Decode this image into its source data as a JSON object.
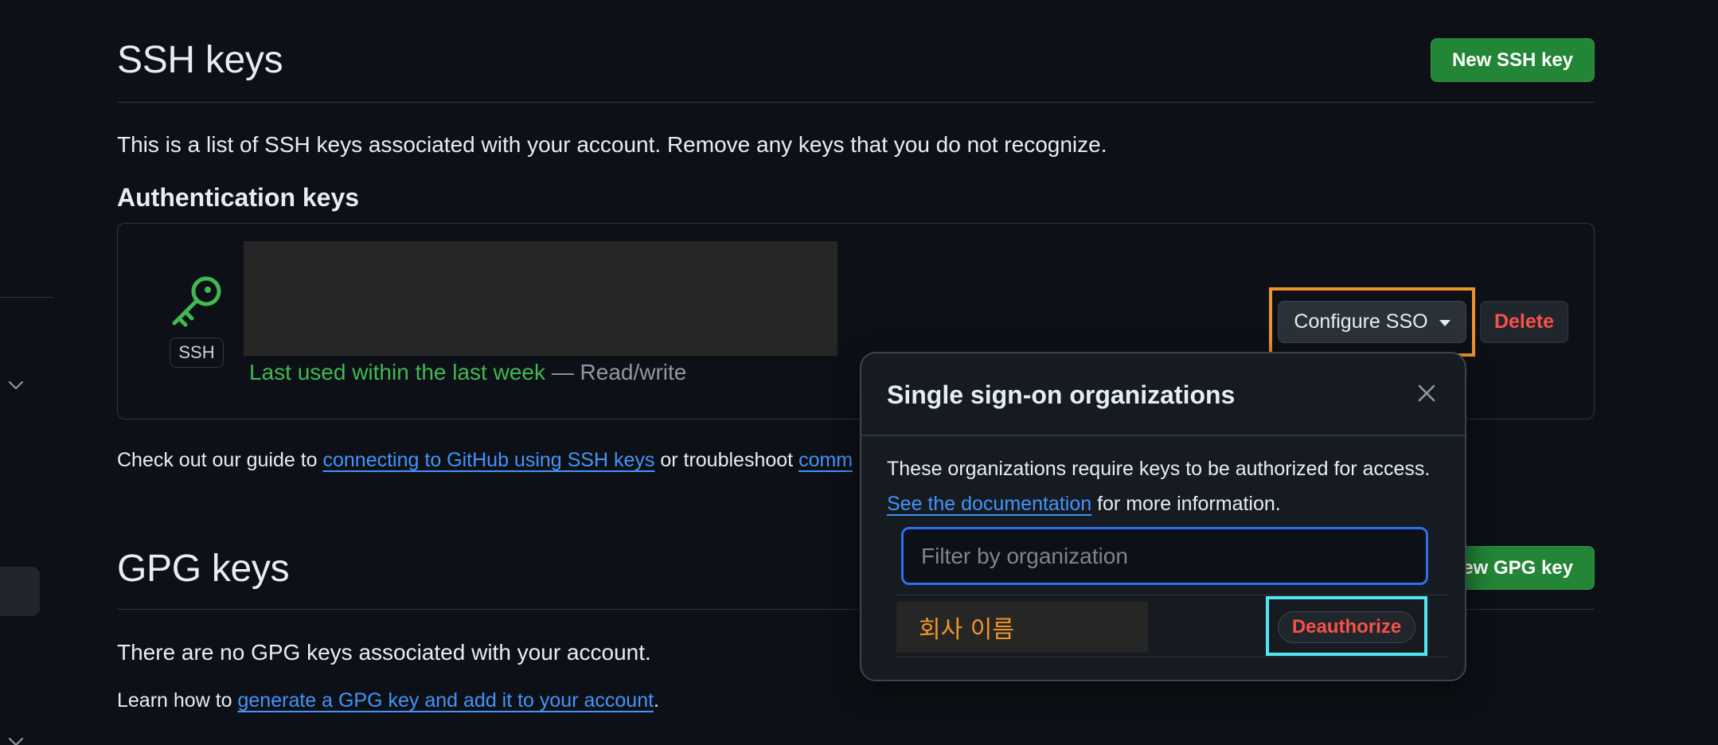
{
  "ssh": {
    "title": "SSH keys",
    "new_button": "New SSH key",
    "description": "This is a list of SSH keys associated with your account. Remove any keys that you do not recognize.",
    "auth_heading": "Authentication keys",
    "key": {
      "type_badge": "SSH",
      "last_used": "Last used within the last week",
      "access": " — Read/write"
    },
    "configure_sso_label": "Configure SSO",
    "delete_label": "Delete",
    "guide_prefix": "Check out our guide to ",
    "guide_link": "connecting to GitHub using SSH keys",
    "guide_middle": " or troubleshoot ",
    "guide_link2": "comm"
  },
  "gpg": {
    "title": "GPG keys",
    "new_button": "New GPG key",
    "empty_text": "There are no GPG keys associated with your account.",
    "learn_prefix": "Learn how to ",
    "learn_link": "generate a GPG key and add it to your account",
    "learn_suffix": "."
  },
  "sso_popover": {
    "title": "Single sign-on organizations",
    "description_line1": "These organizations require keys to be authorized for access.",
    "doc_link": "See the documentation",
    "description_line2_suffix": " for more information.",
    "filter_placeholder": "Filter by organization",
    "organizations": [
      {
        "name": "회사 이름",
        "action_label": "Deauthorize"
      }
    ]
  },
  "colors": {
    "background": "#0d1117",
    "primary_button": "#238636",
    "danger": "#f85149",
    "link": "#4493f8",
    "success": "#3fb950",
    "annotation_orange": "#f0932b",
    "annotation_cyan": "#4fe8f2"
  },
  "icons": [
    "key-icon",
    "chevron-down-icon",
    "close-icon",
    "caret-down-icon"
  ]
}
